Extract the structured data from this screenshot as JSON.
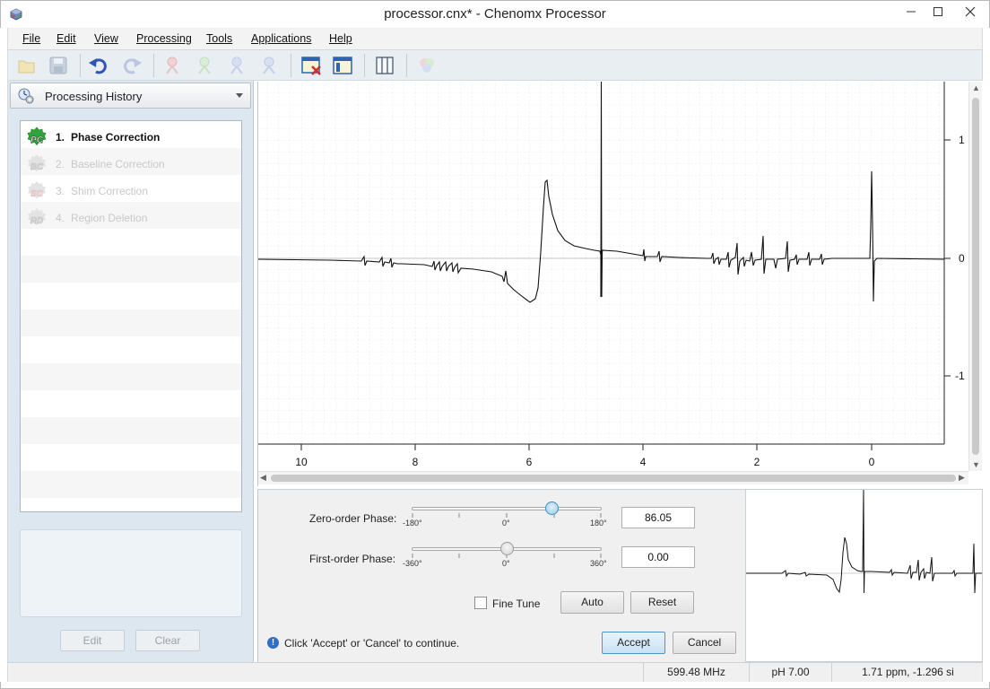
{
  "window": {
    "title": "processor.cnx* - Chenomx Processor"
  },
  "menu": [
    "File",
    "Edit",
    "View",
    "Processing",
    "Tools",
    "Applications",
    "Help"
  ],
  "toolbar": {
    "icons": [
      "open-folder-icon",
      "save-icon",
      "undo-icon",
      "redo-icon",
      "person-pin-icon",
      "person-pin-icon",
      "person-pin-icon",
      "person-pin-icon",
      "delete-region-icon",
      "window-layout-icon",
      "columns-icon",
      "compounds-icon"
    ]
  },
  "history": {
    "header": "Processing History",
    "items": [
      {
        "num": "1.",
        "label": "Phase Correction",
        "badge": "PC",
        "active": true
      },
      {
        "num": "2.",
        "label": "Baseline Correction",
        "badge": "BC",
        "active": false
      },
      {
        "num": "3.",
        "label": "Shim Correction",
        "badge": "SC",
        "active": false
      },
      {
        "num": "4.",
        "label": "Region Deletion",
        "badge": "RD",
        "active": false
      }
    ],
    "edit_label": "Edit",
    "clear_label": "Clear"
  },
  "spectrum": {
    "x_ticks": [
      "10",
      "8",
      "6",
      "4",
      "2",
      "0"
    ],
    "y_ticks": [
      "1",
      "0",
      "-1"
    ]
  },
  "phase": {
    "zero_order": {
      "label": "Zero-order Phase:",
      "min": "-180°",
      "mid": "0°",
      "max": "180°",
      "value": "86.05",
      "fraction": 0.739
    },
    "first_order": {
      "label": "First-order Phase:",
      "min": "-360°",
      "mid": "0°",
      "max": "360°",
      "value": "0.00",
      "fraction": 0.5
    },
    "fine_tune_label": "Fine Tune",
    "auto_label": "Auto",
    "reset_label": "Reset",
    "accept_label": "Accept",
    "cancel_label": "Cancel",
    "info_text": "Click 'Accept' or 'Cancel' to continue."
  },
  "status": {
    "frequency": "599.48 MHz",
    "ph": "pH 7.00",
    "cursor": "1.71 ppm, -1.296 si"
  }
}
